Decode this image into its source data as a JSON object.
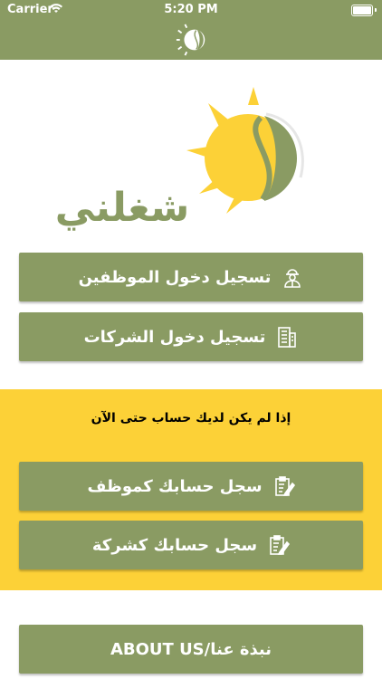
{
  "status_bar": {
    "carrier": "Carrier",
    "time": "5:20 PM"
  },
  "colors": {
    "primary": "#8a9b63",
    "accent_yellow": "#fcd137",
    "white": "#ffffff"
  },
  "hero": {
    "app_name": "شغلني"
  },
  "buttons": {
    "employee_login": "تسجيل دخول الموظفين",
    "company_login": "تسجيل دخول الشركات",
    "register_employee": "سجل حسابك كموظف",
    "register_company": "سجل حسابك كشركة",
    "about_us": "نبذة عنا/ABOUT US"
  },
  "prompt": {
    "no_account": "إذا لم يكن لديك حساب حتى الآن"
  },
  "icons": {
    "employee": "worker-icon",
    "company": "building-icon",
    "register": "clipboard-edit-icon",
    "logo": "sun-leaf-logo-icon"
  }
}
